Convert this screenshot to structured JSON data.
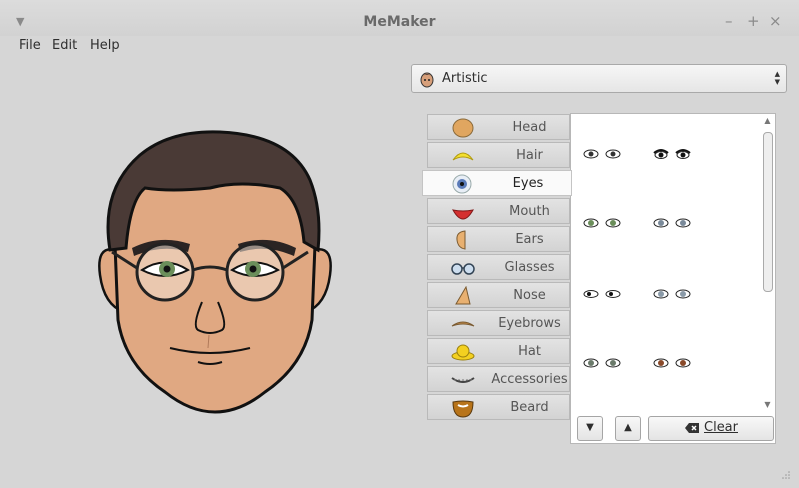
{
  "window": {
    "title": "MeMaker",
    "left_icon": "triangle-down-icon"
  },
  "window_controls": {
    "minimize": "–",
    "maximize": "+",
    "close": "×"
  },
  "menu": {
    "file": "File",
    "edit": "Edit",
    "help": "Help"
  },
  "style_select": {
    "value": "Artistic",
    "icon": "face-icon"
  },
  "categories": [
    {
      "label": "Head",
      "icon": "head-icon"
    },
    {
      "label": "Hair",
      "icon": "hair-icon"
    },
    {
      "label": "Eyes",
      "icon": "eye-icon",
      "active": true
    },
    {
      "label": "Mouth",
      "icon": "mouth-icon"
    },
    {
      "label": "Ears",
      "icon": "ear-icon"
    },
    {
      "label": "Glasses",
      "icon": "glasses-icon"
    },
    {
      "label": "Nose",
      "icon": "nose-icon"
    },
    {
      "label": "Eyebrows",
      "icon": "eyebrow-icon"
    },
    {
      "label": "Hat",
      "icon": "hat-icon"
    },
    {
      "label": "Accessories",
      "icon": "accessories-icon"
    },
    {
      "label": "Beard",
      "icon": "beard-icon"
    }
  ],
  "buttons": {
    "down": "▼",
    "up": "▲",
    "clear": "Clear"
  },
  "colors": {
    "skin": "#e0a882",
    "hair": "#4a3a36",
    "iris": "#6b8e5a",
    "accent": "#c49a5a"
  }
}
